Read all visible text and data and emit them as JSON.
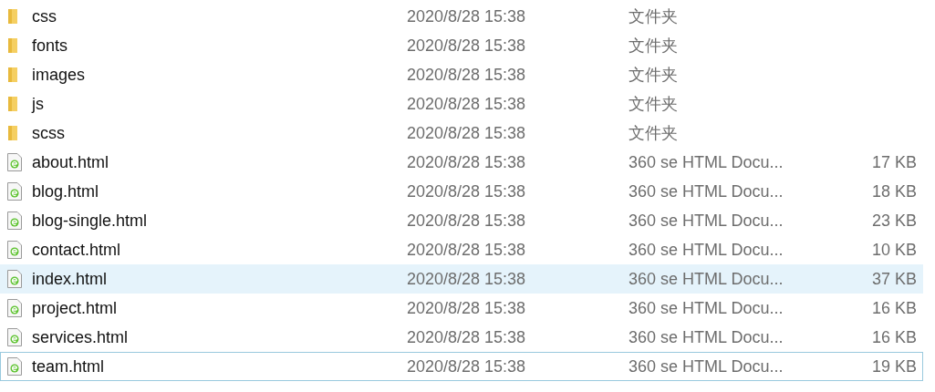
{
  "files": [
    {
      "name": "css",
      "kind": "folder",
      "date": "2020/8/28 15:38",
      "type": "文件夹",
      "highlighted": false,
      "focused": false
    },
    {
      "name": "fonts",
      "kind": "folder",
      "date": "2020/8/28 15:38",
      "type": "文件夹",
      "highlighted": false,
      "focused": false
    },
    {
      "name": "images",
      "kind": "folder",
      "date": "2020/8/28 15:38",
      "type": "文件夹",
      "highlighted": false,
      "focused": false
    },
    {
      "name": "js",
      "kind": "folder",
      "date": "2020/8/28 15:38",
      "type": "文件夹",
      "highlighted": false,
      "focused": false
    },
    {
      "name": "scss",
      "kind": "folder",
      "date": "2020/8/28 15:38",
      "type": "文件夹",
      "highlighted": false,
      "focused": false
    },
    {
      "name": "about.html",
      "kind": "html",
      "date": "2020/8/28 15:38",
      "type": "360 se HTML Docu...",
      "size": "17 KB",
      "highlighted": false,
      "focused": false
    },
    {
      "name": "blog.html",
      "kind": "html",
      "date": "2020/8/28 15:38",
      "type": "360 se HTML Docu...",
      "size": "18 KB",
      "highlighted": false,
      "focused": false
    },
    {
      "name": "blog-single.html",
      "kind": "html",
      "date": "2020/8/28 15:38",
      "type": "360 se HTML Docu...",
      "size": "23 KB",
      "highlighted": false,
      "focused": false
    },
    {
      "name": "contact.html",
      "kind": "html",
      "date": "2020/8/28 15:38",
      "type": "360 se HTML Docu...",
      "size": "10 KB",
      "highlighted": false,
      "focused": false
    },
    {
      "name": "index.html",
      "kind": "html",
      "date": "2020/8/28 15:38",
      "type": "360 se HTML Docu...",
      "size": "37 KB",
      "highlighted": true,
      "focused": false
    },
    {
      "name": "project.html",
      "kind": "html",
      "date": "2020/8/28 15:38",
      "type": "360 se HTML Docu...",
      "size": "16 KB",
      "highlighted": false,
      "focused": false
    },
    {
      "name": "services.html",
      "kind": "html",
      "date": "2020/8/28 15:38",
      "type": "360 se HTML Docu...",
      "size": "16 KB",
      "highlighted": false,
      "focused": false
    },
    {
      "name": "team.html",
      "kind": "html",
      "date": "2020/8/28 15:38",
      "type": "360 se HTML Docu...",
      "size": "19 KB",
      "highlighted": false,
      "focused": true
    }
  ]
}
